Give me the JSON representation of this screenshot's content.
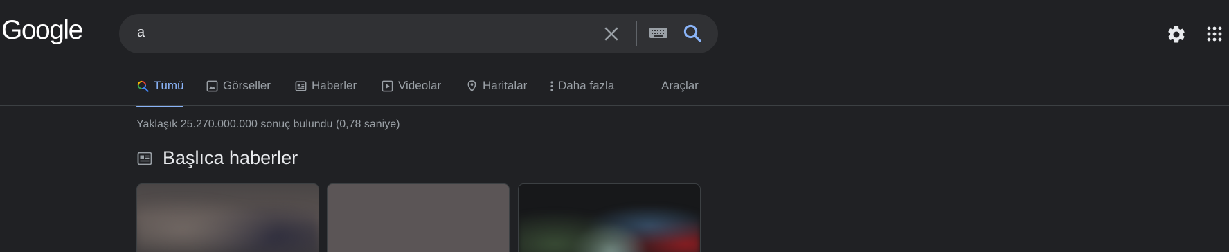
{
  "logo": {
    "text": "Google"
  },
  "search": {
    "query": "a",
    "clear_icon": "close-icon",
    "keyboard_icon": "keyboard-icon",
    "search_icon": "search-icon"
  },
  "header": {
    "settings_icon": "gear-icon",
    "apps_icon": "apps-grid-icon"
  },
  "tabs": [
    {
      "label": "Tümü",
      "icon": "search-multicolor-icon",
      "active": true
    },
    {
      "label": "Görseller",
      "icon": "image-icon",
      "active": false
    },
    {
      "label": "Haberler",
      "icon": "news-icon",
      "active": false
    },
    {
      "label": "Videolar",
      "icon": "play-icon",
      "active": false
    },
    {
      "label": "Haritalar",
      "icon": "map-pin-icon",
      "active": false
    },
    {
      "label": "Daha fazla",
      "icon": "more-vert-icon",
      "active": false
    },
    {
      "label": "Araçlar",
      "icon": "",
      "active": false
    }
  ],
  "results": {
    "stats": "Yaklaşık 25.270.000.000 sonuç bulundu (0,78 saniye)"
  },
  "top_stories": {
    "title": "Başlıca haberler",
    "icon": "news-icon"
  },
  "colors": {
    "background": "#202124",
    "accent": "#8ab4f8",
    "search_bg": "#303134"
  }
}
